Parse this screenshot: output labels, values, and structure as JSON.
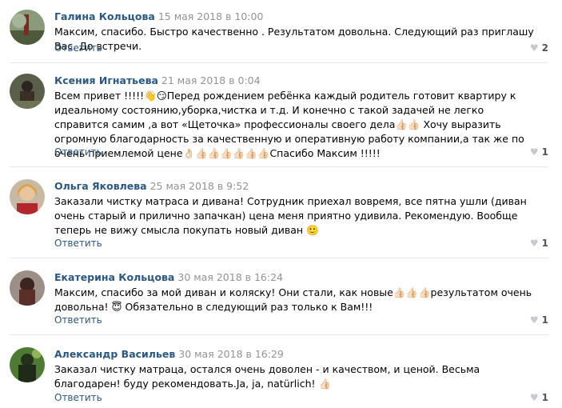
{
  "reply_label": "Ответить",
  "heart_icon": "heart-icon",
  "comments": [
    {
      "author": "Галина Кольцова",
      "date": "15 мая 2018 в 10:00",
      "text": "Максим, спасибо. Быстро качественно . Результатом довольна. Следующий раз приглашу Вас. До встречи.",
      "likes": "2"
    },
    {
      "author": "Ксения Игнатьева",
      "date": "21 мая 2018 в 0:04",
      "text": "Всем привет !!!!!👋😏Перед рождением ребёнка каждый родитель готовит квартиру к идеальному состоянию,уборка,чистка и т.д. И конечно с такой задачей не легко справится самим ,а вот «Щеточка» профессионалы своего дела👍🏻👍🏻 Хочу выразить огромную благодарность за качественную и оперативную работу компании,а так же по очень приемлемой цене👌🏻👍🏻👍🏻👍🏻👍🏻👍🏻👍🏻Спасибо Максим !!!!!",
      "likes": "1"
    },
    {
      "author": "Ольга Яковлева",
      "date": "25 мая 2018 в 9:52",
      "text": "Заказали чистку матраса и дивана! Сотрудник приехал вовремя, все пятна ушли (диван очень старый и прилично запачкан) цена меня приятно удивила. Рекомендую. Вообще теперь не вижу смысла покупать новый диван 🙂",
      "likes": "1"
    },
    {
      "author": "Екатерина Кольцова",
      "date": "30 мая 2018 в 16:24",
      "text": "Максим, спасибо за мой диван и коляску! Они стали, как новые👍🏻👍🏻👍🏻результатом очень довольна! 😇 Обязательно в следующий раз только к Вам!!!",
      "likes": "1"
    },
    {
      "author": "Александр Васильев",
      "date": "30 мая 2018 в 16:29",
      "text": "Заказал чистку матраца, остался очень доволен - и качеством, и ценой. Весьма благодарен! буду рекомендовать.Ja, ja, natürlich! 👍🏻",
      "likes": "1"
    }
  ]
}
